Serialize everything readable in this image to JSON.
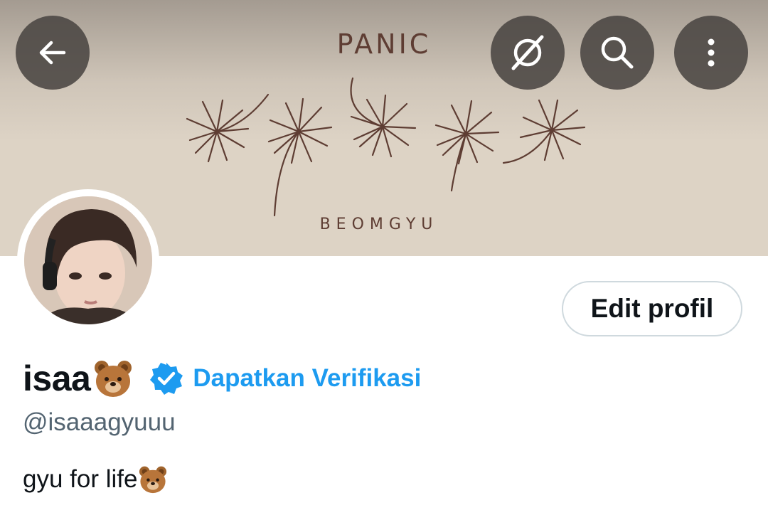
{
  "banner": {
    "top_text": "PANIC",
    "bottom_text": "BEOMGYU",
    "ink_color": "#5e3d33"
  },
  "nav": {
    "back_icon": "arrow-left-icon",
    "grok_icon": "grok-icon",
    "search_icon": "search-icon",
    "more_icon": "more-vertical-icon"
  },
  "profile": {
    "edit_button_label": "Edit profil",
    "display_name": "isaa",
    "name_emoji": "bear-face-icon",
    "verified_badge": "verified-badge-icon",
    "verification_link": "Dapatkan Verifikasi",
    "handle": "@isaaagyuuu",
    "bio": "gyu for life",
    "bio_emoji": "bear-face-icon"
  },
  "colors": {
    "accent": "#1d9bf0",
    "text_primary": "#0f1419",
    "text_secondary": "#536471",
    "button_overlay": "#4a4642"
  }
}
